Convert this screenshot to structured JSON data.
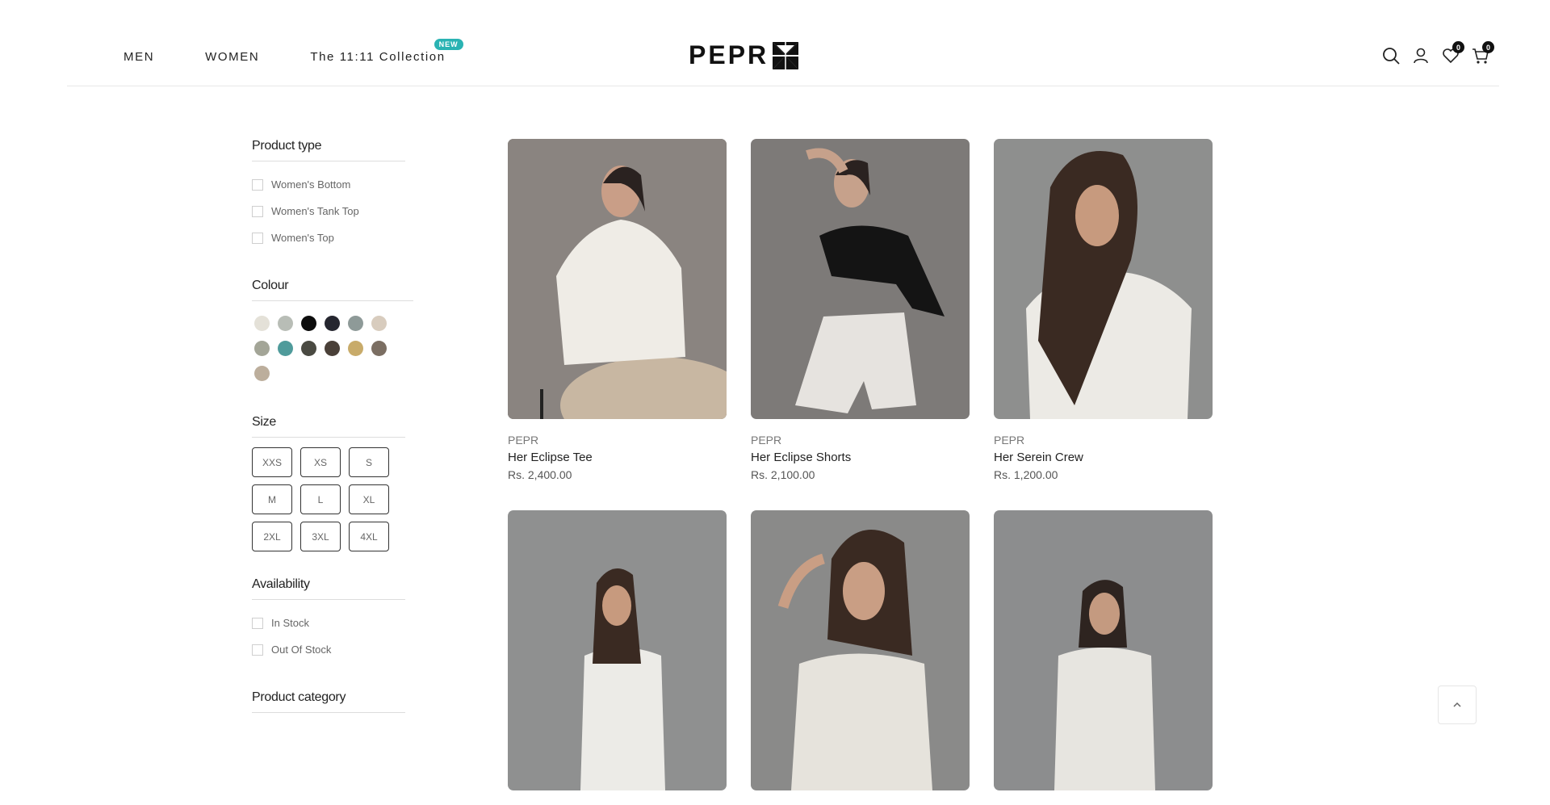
{
  "nav": {
    "men": "MEN",
    "women": "WOMEN",
    "collection": "The 11:11 Collection",
    "badge": "NEW"
  },
  "brand": {
    "logo": "PEPR"
  },
  "header": {
    "wishlist_count": "0",
    "cart_count": "0"
  },
  "filters": {
    "product_type": {
      "title": "Product type",
      "options": [
        "Women's Bottom",
        "Women's Tank Top",
        "Women's Top"
      ]
    },
    "colour": {
      "title": "Colour",
      "swatches": [
        "#e4e1d8",
        "#b8bdb6",
        "#0d0d0d",
        "#25262f",
        "#8e9a98",
        "#d8ccbe",
        "#a3a597",
        "#4f9b9b",
        "#4a4a42",
        "#4a4038",
        "#c8ab6a",
        "#7b6e62",
        "#bcae9c"
      ]
    },
    "size": {
      "title": "Size",
      "options": [
        "XXS",
        "XS",
        "S",
        "M",
        "L",
        "XL",
        "2XL",
        "3XL",
        "4XL"
      ]
    },
    "availability": {
      "title": "Availability",
      "options": [
        "In Stock",
        "Out Of Stock"
      ]
    },
    "product_category": {
      "title": "Product category"
    }
  },
  "products": [
    {
      "vendor": "PEPR",
      "name": "Her Eclipse Tee",
      "price": "Rs. 2,400.00"
    },
    {
      "vendor": "PEPR",
      "name": "Her Eclipse Shorts",
      "price": "Rs. 2,100.00"
    },
    {
      "vendor": "PEPR",
      "name": "Her Serein Crew",
      "price": "Rs. 1,200.00"
    },
    {
      "vendor": "",
      "name": "",
      "price": ""
    },
    {
      "vendor": "",
      "name": "",
      "price": ""
    },
    {
      "vendor": "",
      "name": "",
      "price": ""
    }
  ]
}
